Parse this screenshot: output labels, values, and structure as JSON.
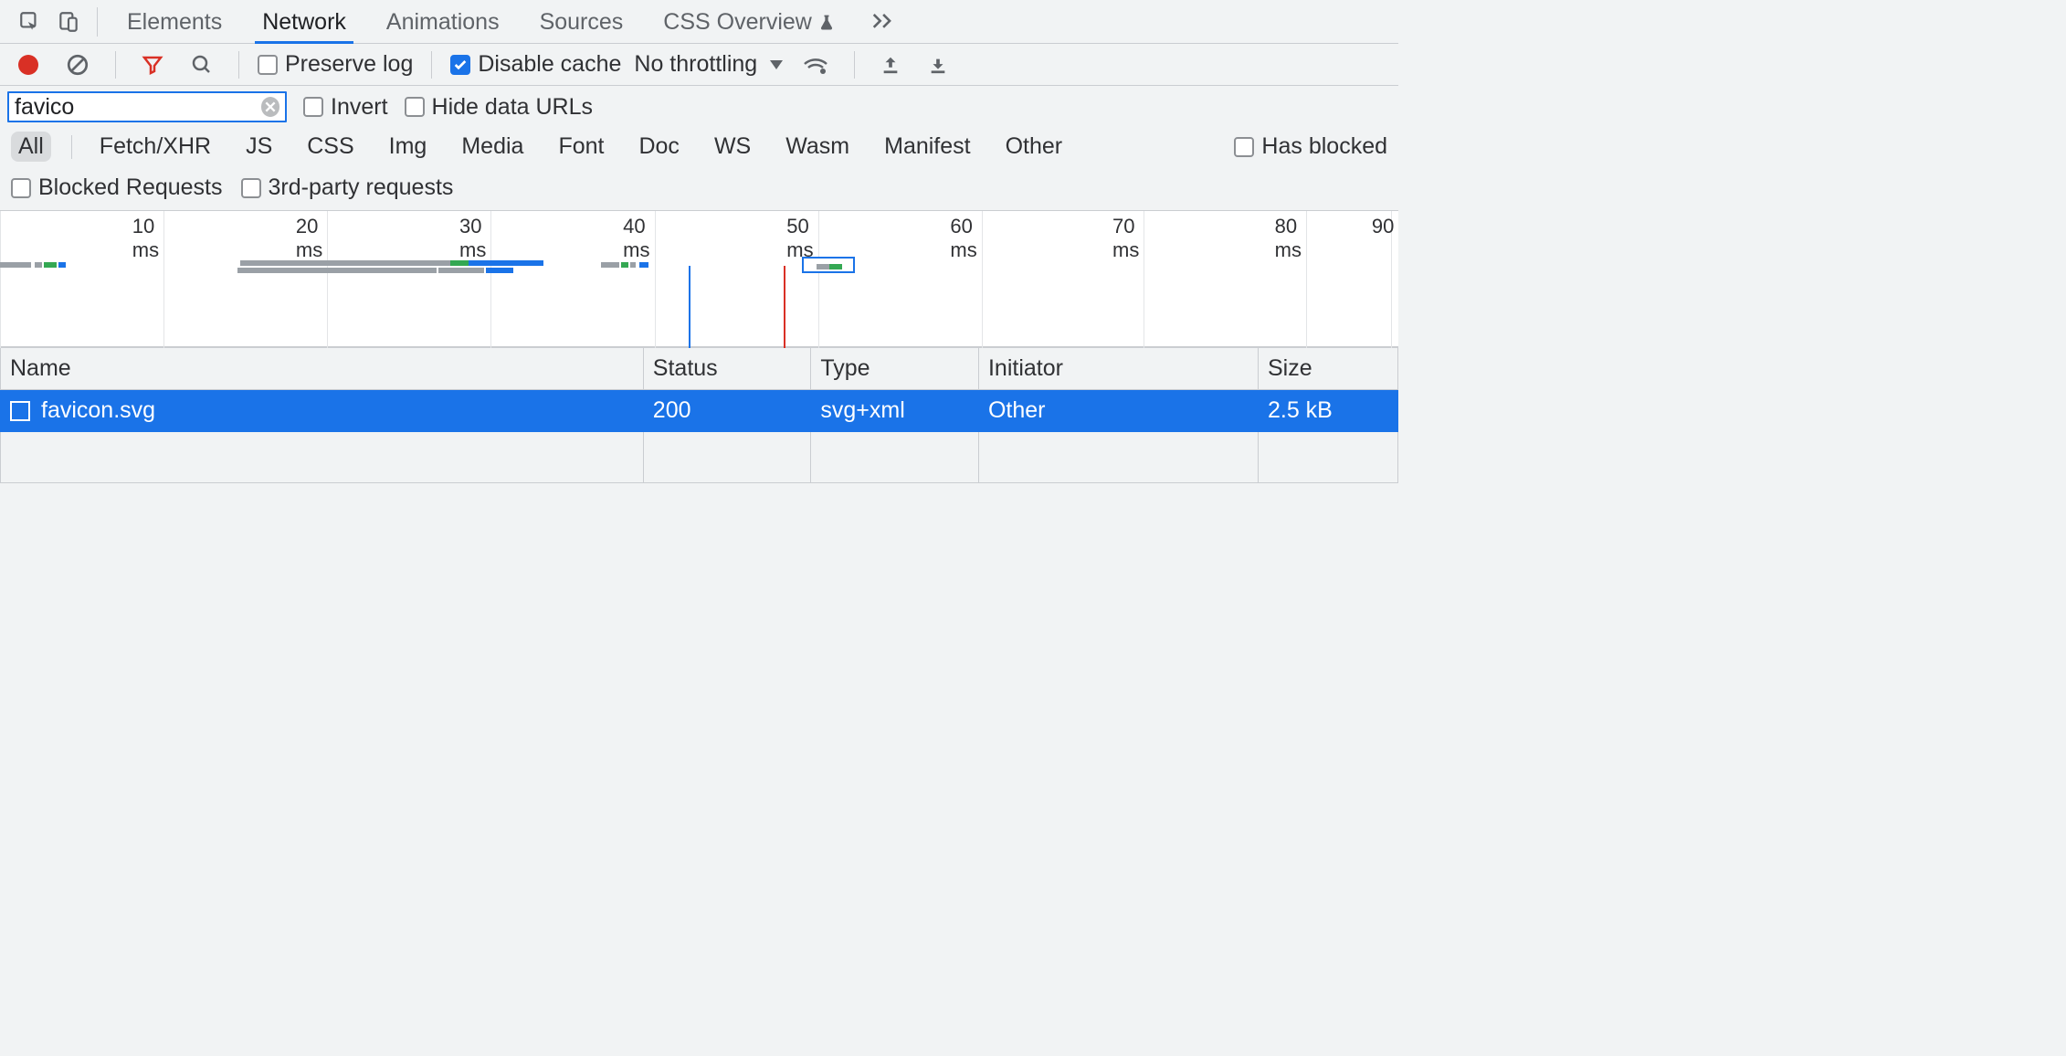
{
  "tabs": {
    "elements": "Elements",
    "network": "Network",
    "animations": "Animations",
    "sources": "Sources",
    "css_overview": "CSS Overview"
  },
  "toolbar": {
    "preserve_log": "Preserve log",
    "disable_cache": "Disable cache",
    "throttling": "No throttling"
  },
  "filter": {
    "value": "favico",
    "invert": "Invert",
    "hide_data_urls": "Hide data URLs"
  },
  "type_filters": {
    "all": "All",
    "fetch_xhr": "Fetch/XHR",
    "js": "JS",
    "css": "CSS",
    "img": "Img",
    "media": "Media",
    "font": "Font",
    "doc": "Doc",
    "ws": "WS",
    "wasm": "Wasm",
    "manifest": "Manifest",
    "other": "Other",
    "has_blocked": "Has blocked"
  },
  "extra_filters": {
    "blocked_requests": "Blocked Requests",
    "third_party": "3rd-party requests"
  },
  "timeline": {
    "ticks": [
      "10 ms",
      "20 ms",
      "30 ms",
      "40 ms",
      "50 ms",
      "60 ms",
      "70 ms",
      "80 ms",
      "90 "
    ]
  },
  "columns": {
    "name": "Name",
    "status": "Status",
    "type": "Type",
    "initiator": "Initiator",
    "size": "Size"
  },
  "rows": [
    {
      "name": "favicon.svg",
      "status": "200",
      "type": "svg+xml",
      "initiator": "Other",
      "size": "2.5 kB"
    }
  ]
}
